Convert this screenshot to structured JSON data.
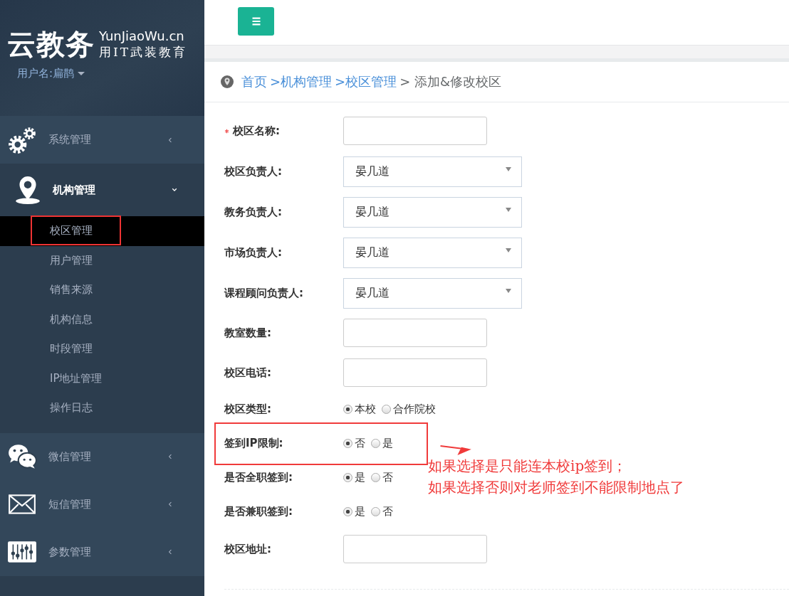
{
  "logo": {
    "title": "云教务",
    "domain": "YunJiaoWu.cn",
    "slogan": "用IT武装教育"
  },
  "user": {
    "label": "用户名:扁鹊"
  },
  "menu": [
    {
      "label": "系统管理",
      "expanded": false
    },
    {
      "label": "机构管理",
      "expanded": true,
      "children": [
        {
          "label": "校区管理",
          "selected": true,
          "highlighted": true
        },
        {
          "label": "用户管理",
          "selected": false,
          "highlighted": false
        },
        {
          "label": "销售来源",
          "selected": false,
          "highlighted": false
        },
        {
          "label": "机构信息",
          "selected": false,
          "highlighted": false
        },
        {
          "label": "时段管理",
          "selected": false,
          "highlighted": false
        },
        {
          "label": "IP地址管理",
          "selected": false,
          "highlighted": false
        },
        {
          "label": "操作日志",
          "selected": false,
          "highlighted": false
        }
      ]
    },
    {
      "label": "微信管理",
      "expanded": false
    },
    {
      "label": "短信管理",
      "expanded": false
    },
    {
      "label": "参数管理",
      "expanded": false
    }
  ],
  "breadcrumb": [
    {
      "text": "首页",
      "kind": "link"
    },
    {
      "text": ">机构管理",
      "kind": "link"
    },
    {
      "text": ">校区管理",
      "kind": "link"
    },
    {
      "text": "> 添加&修改校区",
      "kind": "current"
    }
  ],
  "form": [
    {
      "label": "校区名称:",
      "kind": "text",
      "required": true,
      "highlighted": false
    },
    {
      "label": "校区负责人:",
      "kind": "select",
      "value": "晏几道",
      "required": false,
      "highlighted": false
    },
    {
      "label": "教务负责人:",
      "kind": "select",
      "value": "晏几道",
      "required": false,
      "highlighted": false
    },
    {
      "label": "市场负责人:",
      "kind": "select",
      "value": "晏几道",
      "required": false,
      "highlighted": false
    },
    {
      "label": "课程顾问负责人:",
      "kind": "select",
      "value": "晏几道",
      "required": false,
      "highlighted": false
    },
    {
      "label": "教室数量:",
      "kind": "text",
      "required": false,
      "highlighted": false
    },
    {
      "label": "校区电话:",
      "kind": "text",
      "required": false,
      "highlighted": false
    },
    {
      "label": "校区类型:",
      "kind": "radio",
      "required": false,
      "highlighted": false,
      "options": [
        {
          "label": "本校",
          "selected": true
        },
        {
          "label": "合作院校",
          "selected": false
        }
      ]
    },
    {
      "label": "签到IP限制:",
      "kind": "radio",
      "required": false,
      "highlighted": true,
      "options": [
        {
          "label": "否",
          "selected": true
        },
        {
          "label": "是",
          "selected": false
        }
      ]
    },
    {
      "label": "是否全职签到:",
      "kind": "radio",
      "required": false,
      "highlighted": false,
      "options": [
        {
          "label": "是",
          "selected": true
        },
        {
          "label": "否",
          "selected": false
        }
      ]
    },
    {
      "label": "是否兼职签到:",
      "kind": "radio",
      "required": false,
      "highlighted": false,
      "options": [
        {
          "label": "是",
          "selected": true
        },
        {
          "label": "否",
          "selected": false
        }
      ]
    },
    {
      "label": "校区地址:",
      "kind": "text",
      "required": false,
      "highlighted": false
    }
  ],
  "annotation": {
    "lines": [
      "如果选择是只能连本校ip签到；",
      "如果选择否则对老师签到不能限制地点了"
    ]
  }
}
